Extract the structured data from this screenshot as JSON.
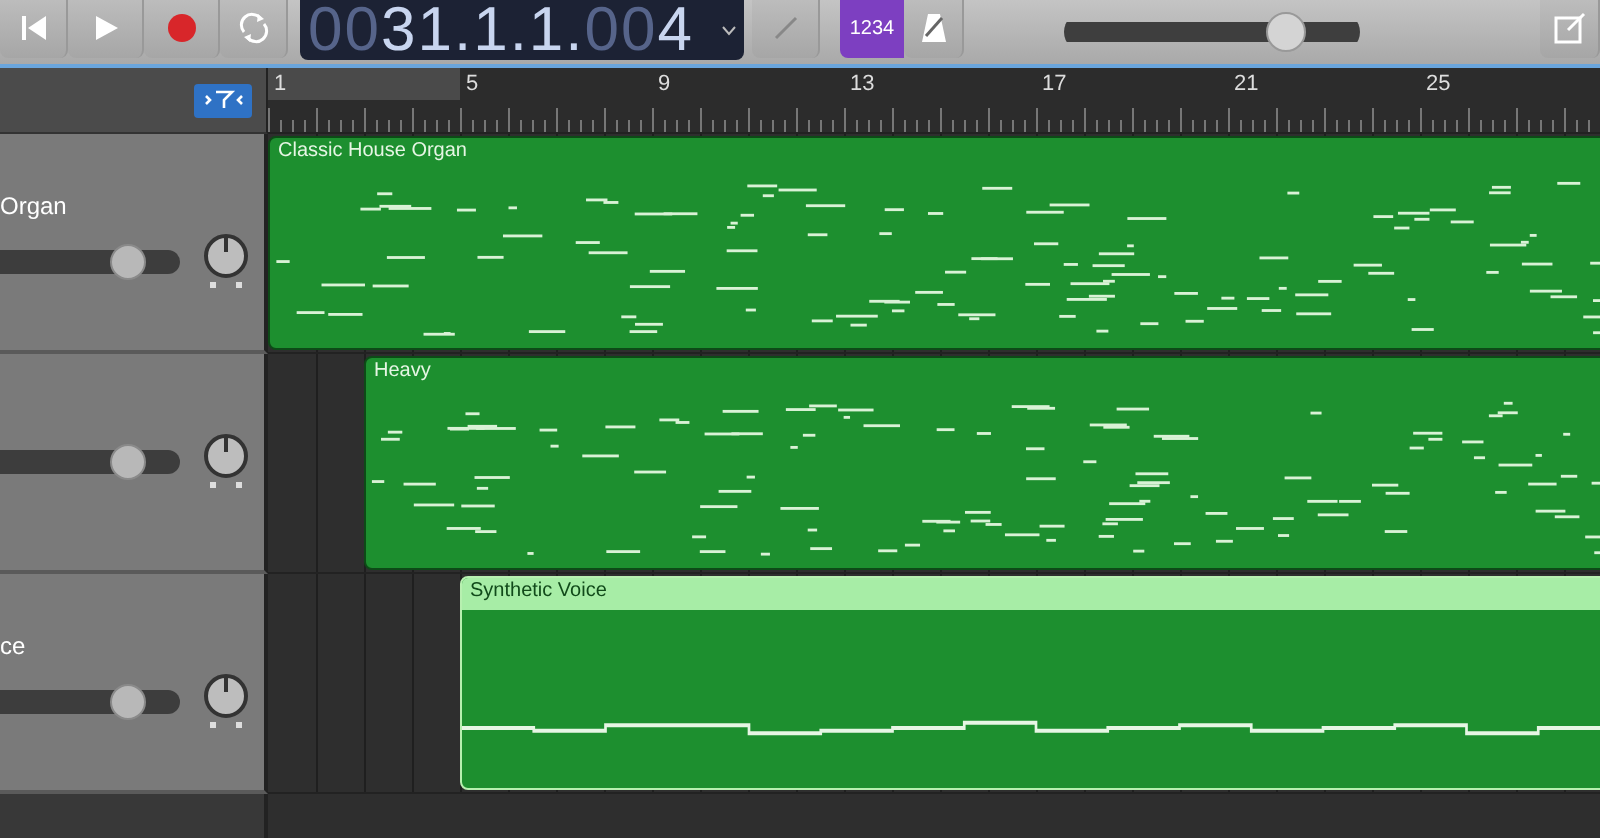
{
  "toolbar": {
    "transport": [
      {
        "kind": "rewind"
      },
      {
        "kind": "play"
      },
      {
        "kind": "record"
      },
      {
        "kind": "cycle"
      }
    ],
    "lcd": [
      {
        "text": "00",
        "dim": true
      },
      {
        "text": "31.1.1.",
        "dim": false
      },
      {
        "text": "00",
        "dim": true
      },
      {
        "text": "4",
        "dim": false
      }
    ],
    "count_in": {
      "label": "1234",
      "on": true
    },
    "master_volume": {
      "level": 0.74
    }
  },
  "ruler": {
    "bars": [
      "1",
      "5",
      "9",
      "13",
      "17",
      "21",
      "25"
    ]
  },
  "tracks": [
    {
      "name": "Organ",
      "volume": {
        "level": 0.7
      },
      "region": {
        "name": "Classic House Organ",
        "selected": false,
        "kind": "notes"
      }
    },
    {
      "volume": {
        "level": 0.7
      },
      "region": {
        "name": "Heavy",
        "selected": false,
        "kind": "notes"
      }
    },
    {
      "name": "ce",
      "volume": {
        "level": 0.7
      },
      "region": {
        "name": "Synthetic Voice",
        "selected": true,
        "kind": "voice"
      }
    }
  ]
}
